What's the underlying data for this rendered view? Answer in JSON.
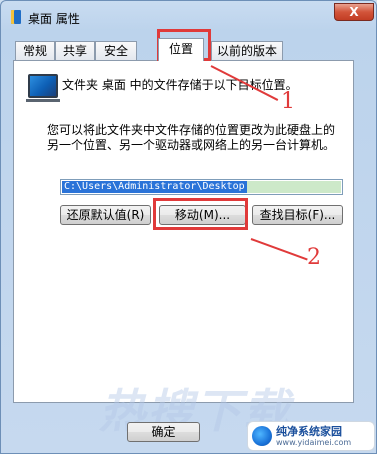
{
  "window": {
    "title": "桌面 属性",
    "close_glyph": "X"
  },
  "tabs": [
    {
      "label": "常规",
      "active": false
    },
    {
      "label": "共享",
      "active": false
    },
    {
      "label": "安全",
      "active": false
    },
    {
      "label": "位置",
      "active": true
    },
    {
      "label": "以前的版本",
      "active": false
    }
  ],
  "panel": {
    "header": "文件夹 桌面 中的文件存储于以下目标位置。",
    "description": "您可以将此文件夹中文件存储的位置更改为此硬盘上的另一个位置、另一个驱动器或网络上的另一台计算机。",
    "path": "C:\\Users\\Administrator\\Desktop",
    "buttons": {
      "restore_default": "还原默认值(R)",
      "move": "移动(M)...",
      "find_target": "查找目标(F)..."
    }
  },
  "footer": {
    "ok_label": "确定"
  },
  "annotations": {
    "label_1": "1",
    "label_2": "2",
    "color": "#e03a3a"
  },
  "watermark": "热搜下载",
  "logo": {
    "name": "纯净系统家园",
    "url": "www.yidaimei.com"
  },
  "icons": {
    "title": "folder-icon",
    "panel": "desktop-folder-icon"
  }
}
